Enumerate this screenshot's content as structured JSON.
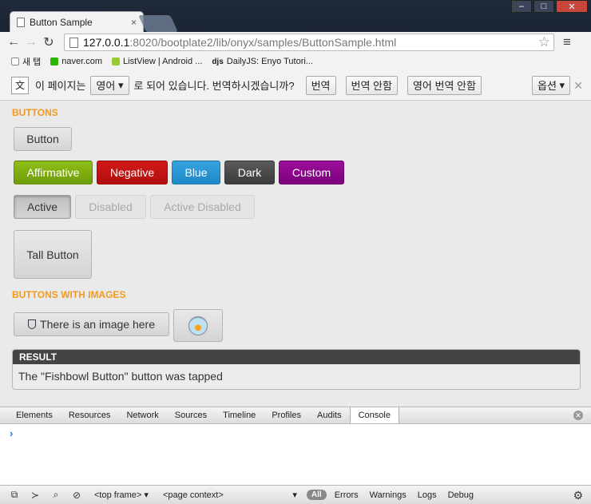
{
  "browser": {
    "tab_title": "Button Sample",
    "url_host": "127.0.0.1",
    "url_path": ":8020/bootplate2/lib/onyx/samples/ButtonSample.html",
    "bookmarks": [
      "새 탭",
      "naver.com",
      "ListView | Android ...",
      "DailyJS: Enyo Tutori..."
    ]
  },
  "translate_bar": {
    "lang": "영어",
    "message_before": "이 페이지는",
    "message_after": "로 되어 있습니다. 번역하시겠습니까?",
    "translate": "번역",
    "no_translate": "번역 안함",
    "never_translate": "영어 번역 안함",
    "options": "옵션"
  },
  "page": {
    "section_buttons": "BUTTONS",
    "section_images": "BUTTONS WITH IMAGES",
    "buttons": {
      "button": "Button",
      "affirmative": "Affirmative",
      "negative": "Negative",
      "blue": "Blue",
      "dark": "Dark",
      "custom": "Custom",
      "active": "Active",
      "disabled": "Disabled",
      "active_disabled": "Active Disabled",
      "tall": "Tall Button",
      "image_text": "There is an image here"
    },
    "result": {
      "title": "RESULT",
      "message": "The \"Fishbowl Button\" button was tapped"
    }
  },
  "devtools": {
    "tabs": [
      "Elements",
      "Resources",
      "Network",
      "Sources",
      "Timeline",
      "Profiles",
      "Audits",
      "Console"
    ],
    "selected_tab": "Console",
    "frame": "<top frame>",
    "context": "<page context>",
    "filters": [
      "All",
      "Errors",
      "Warnings",
      "Logs",
      "Debug"
    ]
  }
}
